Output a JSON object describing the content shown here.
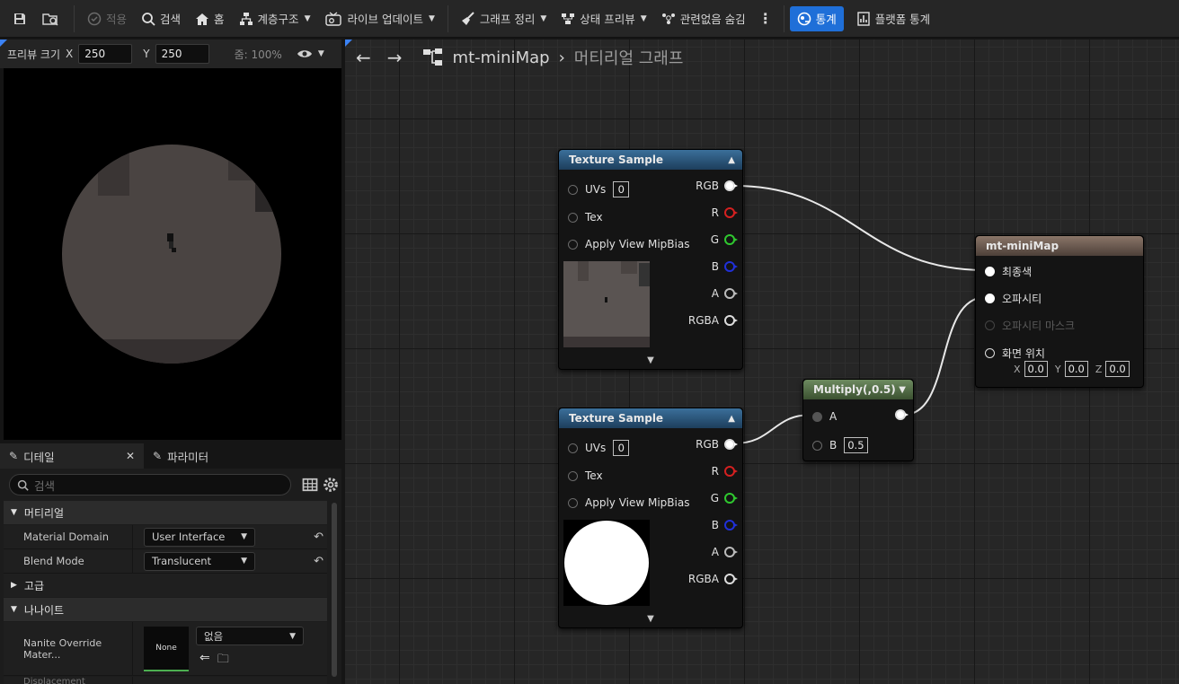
{
  "toolbar": {
    "apply": "적용",
    "search": "검색",
    "home": "홈",
    "hierarchy": "계층구조",
    "live_update": "라이브 업데이트",
    "graph_cleanup": "그래프 정리",
    "state_preview": "상태 프리뷰",
    "hide_unrelated": "관련없음 숨김",
    "stats": "통계",
    "platform_stats": "플랫폼 통계"
  },
  "preview": {
    "size_label": "프리뷰 크기",
    "x_label": "X",
    "x_value": "250",
    "y_label": "Y",
    "y_value": "250",
    "zoom": "줌: 100%"
  },
  "details": {
    "tab_details": "디테일",
    "tab_params": "파라미터",
    "search_placeholder": "검색",
    "cat_material": "머티리얼",
    "material_domain_label": "Material Domain",
    "material_domain_value": "User Interface",
    "blend_mode_label": "Blend Mode",
    "blend_mode_value": "Translucent",
    "cat_advanced": "고급",
    "cat_nanite": "나나이트",
    "nanite_override_label": "Nanite Override Mater...",
    "nanite_thumb": "None",
    "nanite_value": "없음",
    "cut_row_label": "Displacement"
  },
  "graph": {
    "asset_name": "mt-miniMap",
    "sub_title": "머티리얼 그래프",
    "texture_sample_1": {
      "title": "Texture Sample",
      "in_uvs": "UVs",
      "uvs_value": "0",
      "in_tex": "Tex",
      "in_mip": "Apply View MipBias",
      "out_rgb": "RGB",
      "out_r": "R",
      "out_g": "G",
      "out_b": "B",
      "out_a": "A",
      "out_rgba": "RGBA"
    },
    "texture_sample_2": {
      "title": "Texture Sample",
      "in_uvs": "UVs",
      "uvs_value": "0",
      "in_tex": "Tex",
      "in_mip": "Apply View MipBias",
      "out_rgb": "RGB",
      "out_r": "R",
      "out_g": "G",
      "out_b": "B",
      "out_a": "A",
      "out_rgba": "RGBA"
    },
    "multiply": {
      "title": "Multiply(,0.5)",
      "in_a": "A",
      "in_b": "B",
      "b_value": "0.5"
    },
    "material": {
      "title": "mt-miniMap",
      "in_final_color": "최종색",
      "in_opacity": "오파시티",
      "in_opacity_mask": "오파시티 마스크",
      "in_screen_pos": "화면 위치",
      "x_label": "X",
      "x_value": "0.0",
      "y_label": "Y",
      "y_value": "0.0",
      "z_label": "Z",
      "z_value": "0.0"
    }
  },
  "colors": {
    "accent": "#1f6fd8",
    "pin_r": "#d42020",
    "pin_g": "#2fc82f",
    "pin_b": "#2030d8"
  }
}
